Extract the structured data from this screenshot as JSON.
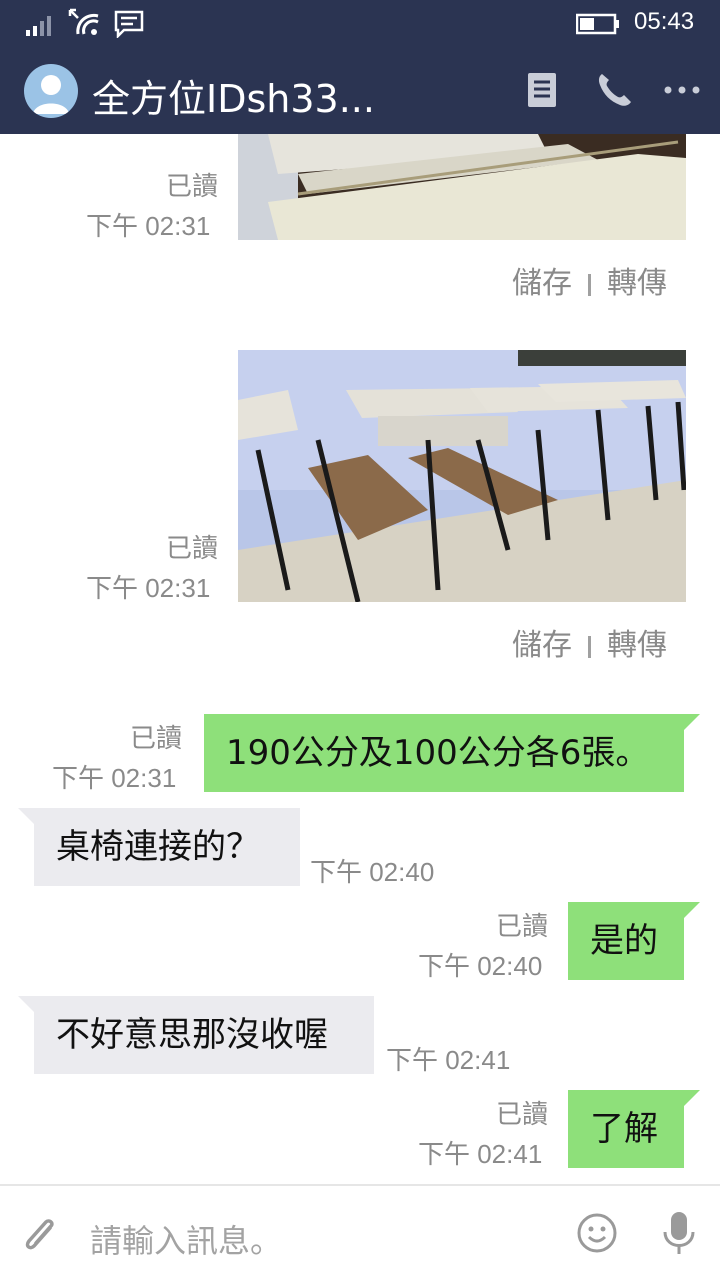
{
  "status_bar": {
    "time": "05:43",
    "icons": [
      "signal-icon",
      "wifi-icon",
      "message-notification-icon",
      "battery-icon"
    ]
  },
  "header": {
    "title": "全方位IDsh33...",
    "icons": [
      "avatar",
      "note-icon",
      "phone-icon",
      "more-icon"
    ],
    "color": "#2b3452"
  },
  "messages": {
    "photo1": {
      "read": "已讀",
      "time": "下午 02:31",
      "save": "儲存",
      "forward": "轉傳"
    },
    "photo2": {
      "read": "已讀",
      "time": "下午 02:31",
      "save": "儲存",
      "forward": "轉傳"
    },
    "m1": {
      "read": "已讀",
      "time": "下午 02:31",
      "text": "190公分及100公分各6張。"
    },
    "m2": {
      "time": "下午 02:40",
      "text": "桌椅連接的？"
    },
    "m3": {
      "read": "已讀",
      "time": "下午 02:40",
      "text": "是的"
    },
    "m4": {
      "time": "下午 02:41",
      "text": "不好意思那沒收喔"
    },
    "m5": {
      "read": "已讀",
      "time": "下午 02:41",
      "text": "了解"
    }
  },
  "input": {
    "placeholder": "請輸入訊息。",
    "icons": [
      "attach-icon",
      "emoji-icon",
      "mic-icon"
    ]
  },
  "colors": {
    "outgoing_bubble": "#8ee07a",
    "incoming_bubble": "#ebebef",
    "meta_text": "#8a8a8a"
  }
}
